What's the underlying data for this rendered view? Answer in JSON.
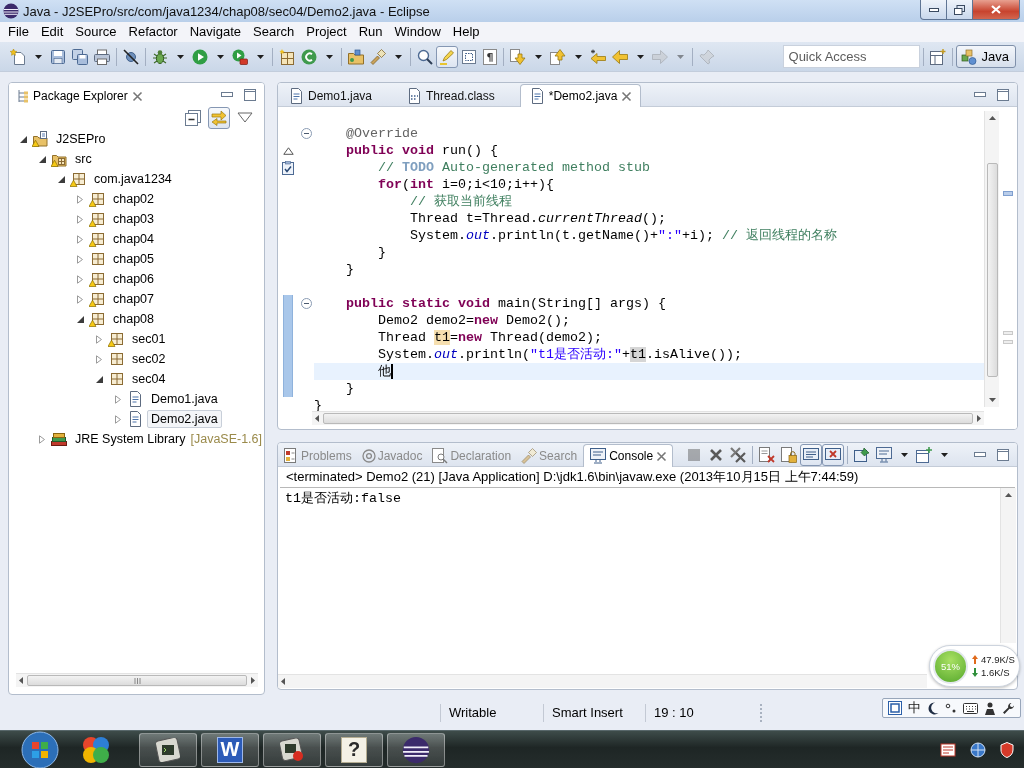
{
  "window": {
    "title": "Java - J2SEPro/src/com/java1234/chap08/sec04/Demo2.java - Eclipse"
  },
  "menu": [
    "File",
    "Edit",
    "Source",
    "Refactor",
    "Navigate",
    "Search",
    "Project",
    "Run",
    "Window",
    "Help"
  ],
  "toolbar": [
    {
      "kind": "new",
      "dropdown": true,
      "pressed": false,
      "disabled": false
    },
    {
      "kind": "save",
      "dropdown": false,
      "pressed": false,
      "disabled": false
    },
    {
      "kind": "save-all",
      "dropdown": false,
      "pressed": false,
      "disabled": false
    },
    {
      "kind": "print",
      "dropdown": false,
      "pressed": false,
      "disabled": false
    },
    {
      "kind": "separator"
    },
    {
      "kind": "skip-breakpoints",
      "dropdown": false,
      "pressed": false,
      "disabled": false
    },
    {
      "kind": "separator"
    },
    {
      "kind": "debug",
      "dropdown": true,
      "pressed": false,
      "disabled": false
    },
    {
      "kind": "run",
      "dropdown": true,
      "pressed": false,
      "disabled": false
    },
    {
      "kind": "external-tools",
      "dropdown": true,
      "pressed": false,
      "disabled": false
    },
    {
      "kind": "separator"
    },
    {
      "kind": "new-package",
      "dropdown": false,
      "pressed": false,
      "disabled": false
    },
    {
      "kind": "new-class",
      "dropdown": true,
      "pressed": false,
      "disabled": false
    },
    {
      "kind": "separator"
    },
    {
      "kind": "open-type",
      "dropdown": false,
      "pressed": false,
      "disabled": false
    },
    {
      "kind": "search",
      "dropdown": true,
      "pressed": false,
      "disabled": false
    },
    {
      "kind": "separator"
    },
    {
      "kind": "breadcrumb",
      "dropdown": false,
      "pressed": false,
      "disabled": false
    },
    {
      "kind": "mark-occurrences",
      "dropdown": false,
      "pressed": true,
      "disabled": false
    },
    {
      "kind": "block-selection",
      "dropdown": false,
      "pressed": false,
      "disabled": false
    },
    {
      "kind": "show-whitespace",
      "glyph": "¶",
      "dropdown": false,
      "pressed": false,
      "disabled": false
    },
    {
      "kind": "separator"
    },
    {
      "kind": "next-annotation",
      "dropdown": true,
      "pressed": false,
      "disabled": false
    },
    {
      "kind": "prev-annotation",
      "dropdown": true,
      "pressed": false,
      "disabled": false
    },
    {
      "kind": "last-edit",
      "dropdown": false,
      "pressed": false,
      "disabled": false
    },
    {
      "kind": "back",
      "dropdown": true,
      "pressed": false,
      "disabled": false
    },
    {
      "kind": "forward",
      "dropdown": true,
      "pressed": false,
      "disabled": true
    },
    {
      "kind": "separator"
    },
    {
      "kind": "pin-editor",
      "dropdown": false,
      "pressed": false,
      "disabled": true
    }
  ],
  "quick_access": {
    "placeholder": "Quick Access"
  },
  "perspectives": [
    {
      "label": "Java",
      "selected": true
    }
  ],
  "package_explorer": {
    "tab": "Package Explorer",
    "view_toolbar": [
      {
        "kind": "collapse-all",
        "pressed": false
      },
      {
        "kind": "link-with-editor",
        "pressed": true
      },
      {
        "kind": "view-menu",
        "pressed": false
      }
    ],
    "tree": [
      {
        "label": "J2SEPro",
        "kind": "project",
        "expanded": true,
        "selected": false,
        "warning": true,
        "children": [
          {
            "label": "src",
            "kind": "source-folder",
            "expanded": true,
            "selected": false,
            "warning": true,
            "children": [
              {
                "label": "com.java1234",
                "kind": "package",
                "expanded": true,
                "selected": false,
                "warning": true,
                "children": [
                  {
                    "label": "chap02",
                    "kind": "package",
                    "expanded": false,
                    "selected": false,
                    "warning": true
                  },
                  {
                    "label": "chap03",
                    "kind": "package",
                    "expanded": false,
                    "selected": false,
                    "warning": true
                  },
                  {
                    "label": "chap04",
                    "kind": "package",
                    "expanded": false,
                    "selected": false,
                    "warning": true
                  },
                  {
                    "label": "chap05",
                    "kind": "package",
                    "expanded": false,
                    "selected": false,
                    "warning": false
                  },
                  {
                    "label": "chap06",
                    "kind": "package",
                    "expanded": false,
                    "selected": false,
                    "warning": true
                  },
                  {
                    "label": "chap07",
                    "kind": "package",
                    "expanded": false,
                    "selected": false,
                    "warning": true
                  },
                  {
                    "label": "chap08",
                    "kind": "package",
                    "expanded": true,
                    "selected": false,
                    "warning": true,
                    "children": [
                      {
                        "label": "sec01",
                        "kind": "package",
                        "expanded": false,
                        "selected": false,
                        "warning": true
                      },
                      {
                        "label": "sec02",
                        "kind": "package",
                        "expanded": false,
                        "selected": false,
                        "warning": false
                      },
                      {
                        "label": "sec04",
                        "kind": "package",
                        "expanded": true,
                        "selected": false,
                        "warning": false,
                        "children": [
                          {
                            "label": "Demo1.java",
                            "kind": "java-file",
                            "expanded": false,
                            "selected": false,
                            "warning": false
                          },
                          {
                            "label": "Demo2.java",
                            "kind": "java-file",
                            "expanded": false,
                            "selected": true,
                            "warning": false
                          }
                        ]
                      }
                    ]
                  }
                ]
              }
            ]
          },
          {
            "label": "JRE System Library",
            "decoration": "[JavaSE-1.6]",
            "kind": "library",
            "expanded": false,
            "selected": false,
            "warning": false
          }
        ]
      }
    ]
  },
  "editor": {
    "tabs": [
      {
        "label": "Demo1.java",
        "kind": "java-file",
        "selected": false
      },
      {
        "label": "Thread.class",
        "kind": "class-file",
        "selected": false
      },
      {
        "label": "*Demo2.java",
        "kind": "java-file",
        "selected": true
      }
    ],
    "lines": [
      {
        "kind": "code",
        "tokens": [
          {
            "kind": "annotation",
            "text": "    @Override"
          }
        ],
        "fold": true,
        "changed": false,
        "current": false
      },
      {
        "kind": "code",
        "tokens": [
          {
            "kind": "keyword",
            "text": "    public void"
          },
          {
            "kind": "plain",
            "text": " run() {"
          }
        ],
        "marker": {
          "kind": "override"
        },
        "fold": false,
        "changed": false,
        "current": false
      },
      {
        "kind": "code",
        "tokens": [
          {
            "kind": "comment",
            "text": "        // "
          },
          {
            "kind": "task-tag",
            "text": "TODO"
          },
          {
            "kind": "comment",
            "text": " Auto-generated method stub"
          }
        ],
        "marker": {
          "kind": "task"
        },
        "fold": false,
        "changed": false,
        "current": false
      },
      {
        "kind": "code",
        "tokens": [
          {
            "kind": "keyword",
            "text": "        for"
          },
          {
            "kind": "plain",
            "text": "("
          },
          {
            "kind": "keyword",
            "text": "int"
          },
          {
            "kind": "plain",
            "text": " i=0;i<10;i++){"
          }
        ],
        "fold": false,
        "changed": false,
        "current": false
      },
      {
        "kind": "code",
        "tokens": [
          {
            "kind": "comment",
            "text": "            // 获取当前线程"
          }
        ],
        "fold": false,
        "changed": false,
        "current": false
      },
      {
        "kind": "code",
        "tokens": [
          {
            "kind": "plain",
            "text": "            Thread t=Thread."
          },
          {
            "kind": "static-method",
            "text": "currentThread"
          },
          {
            "kind": "plain",
            "text": "();"
          }
        ],
        "fold": false,
        "changed": false,
        "current": false
      },
      {
        "kind": "code",
        "tokens": [
          {
            "kind": "plain",
            "text": "            System."
          },
          {
            "kind": "field",
            "text": "out"
          },
          {
            "kind": "plain",
            "text": ".println(t.getName()+"
          },
          {
            "kind": "string",
            "text": "\":\""
          },
          {
            "kind": "plain",
            "text": "+i); "
          },
          {
            "kind": "comment",
            "text": "// 返回线程的名称"
          }
        ],
        "fold": false,
        "changed": false,
        "current": false
      },
      {
        "kind": "code",
        "tokens": [
          {
            "kind": "plain",
            "text": "        }"
          }
        ],
        "fold": false,
        "changed": false,
        "current": false
      },
      {
        "kind": "code",
        "tokens": [
          {
            "kind": "plain",
            "text": "    }"
          }
        ],
        "fold": false,
        "changed": false,
        "current": false
      },
      {
        "kind": "blank"
      },
      {
        "kind": "code",
        "tokens": [
          {
            "kind": "keyword",
            "text": "    public static void"
          },
          {
            "kind": "plain",
            "text": " main(String[] args) {"
          }
        ],
        "fold": true,
        "changed": true,
        "current": false
      },
      {
        "kind": "code",
        "tokens": [
          {
            "kind": "plain",
            "text": "        Demo2 demo2="
          },
          {
            "kind": "keyword",
            "text": "new"
          },
          {
            "kind": "plain",
            "text": " Demo2();"
          }
        ],
        "fold": false,
        "changed": true,
        "current": false
      },
      {
        "kind": "code",
        "tokens": [
          {
            "kind": "plain",
            "text": "        Thread "
          },
          {
            "kind": "write-occurrence",
            "text": "t1"
          },
          {
            "kind": "plain",
            "text": "="
          },
          {
            "kind": "keyword",
            "text": "new"
          },
          {
            "kind": "plain",
            "text": " Thread(demo2);"
          }
        ],
        "fold": false,
        "changed": true,
        "current": false
      },
      {
        "kind": "code",
        "tokens": [
          {
            "kind": "plain",
            "text": "        System."
          },
          {
            "kind": "field",
            "text": "out"
          },
          {
            "kind": "plain",
            "text": ".println("
          },
          {
            "kind": "string",
            "text": "\"t1是否活动:\""
          },
          {
            "kind": "plain",
            "text": "+"
          },
          {
            "kind": "read-occurrence",
            "text": "t1"
          },
          {
            "kind": "plain",
            "text": ".isAlive());"
          }
        ],
        "fold": false,
        "changed": true,
        "current": false
      },
      {
        "kind": "code",
        "tokens": [
          {
            "kind": "plain",
            "text": "        他"
          }
        ],
        "fold": false,
        "changed": true,
        "current": true
      },
      {
        "kind": "code",
        "tokens": [
          {
            "kind": "plain",
            "text": "    }"
          }
        ],
        "fold": false,
        "changed": true,
        "current": false
      },
      {
        "kind": "code",
        "tokens": [
          {
            "kind": "plain",
            "text": "}"
          }
        ],
        "fold": false,
        "changed": false,
        "current": false
      }
    ]
  },
  "console": {
    "tabs": [
      {
        "label": "Problems",
        "kind": "problems",
        "selected": false
      },
      {
        "label": "Javadoc",
        "kind": "javadoc",
        "selected": false
      },
      {
        "label": "Declaration",
        "kind": "declaration",
        "selected": false
      },
      {
        "label": "Search",
        "kind": "search",
        "selected": false
      },
      {
        "label": "Console",
        "kind": "console",
        "selected": true
      }
    ],
    "toolbar": [
      {
        "kind": "terminate",
        "dropdown": false,
        "pressed": false,
        "disabled": true
      },
      {
        "kind": "remove-launch",
        "dropdown": false,
        "pressed": false,
        "disabled": false
      },
      {
        "kind": "remove-all",
        "dropdown": false,
        "pressed": false,
        "disabled": false
      },
      {
        "kind": "separator"
      },
      {
        "kind": "clear",
        "dropdown": false,
        "pressed": false,
        "disabled": false
      },
      {
        "kind": "scroll-lock",
        "dropdown": false,
        "pressed": false,
        "disabled": false
      },
      {
        "kind": "show-on-output",
        "dropdown": false,
        "pressed": true,
        "disabled": false
      },
      {
        "kind": "show-on-error",
        "dropdown": false,
        "pressed": true,
        "disabled": false
      },
      {
        "kind": "separator"
      },
      {
        "kind": "pin-console",
        "dropdown": false,
        "pressed": false,
        "disabled": false
      },
      {
        "kind": "display-console",
        "dropdown": true,
        "pressed": false,
        "disabled": false
      },
      {
        "kind": "open-console",
        "dropdown": true,
        "pressed": false,
        "disabled": false
      }
    ],
    "header": "<terminated> Demo2 (21) [Java Application] D:\\jdk1.6\\bin\\javaw.exe (2013年10月15日 上午7:44:59)",
    "output": [
      "t1是否活动:false"
    ]
  },
  "network_monitor": {
    "usage": "51%",
    "upload": "47.9K/S",
    "download": "1.6K/S"
  },
  "status_bar": [
    "Writable",
    "Smart Insert",
    "19 : 10"
  ],
  "ime_bar": {
    "mode": "中"
  },
  "taskbar": {
    "apps": [
      {
        "kind": "circles",
        "running": false
      },
      {
        "kind": "terminal",
        "running": true
      },
      {
        "kind": "writer",
        "glyph": "W",
        "running": true
      },
      {
        "kind": "terminal-stop",
        "running": true
      },
      {
        "kind": "help",
        "glyph": "?",
        "running": true
      },
      {
        "kind": "sphere",
        "running": true
      }
    ]
  }
}
